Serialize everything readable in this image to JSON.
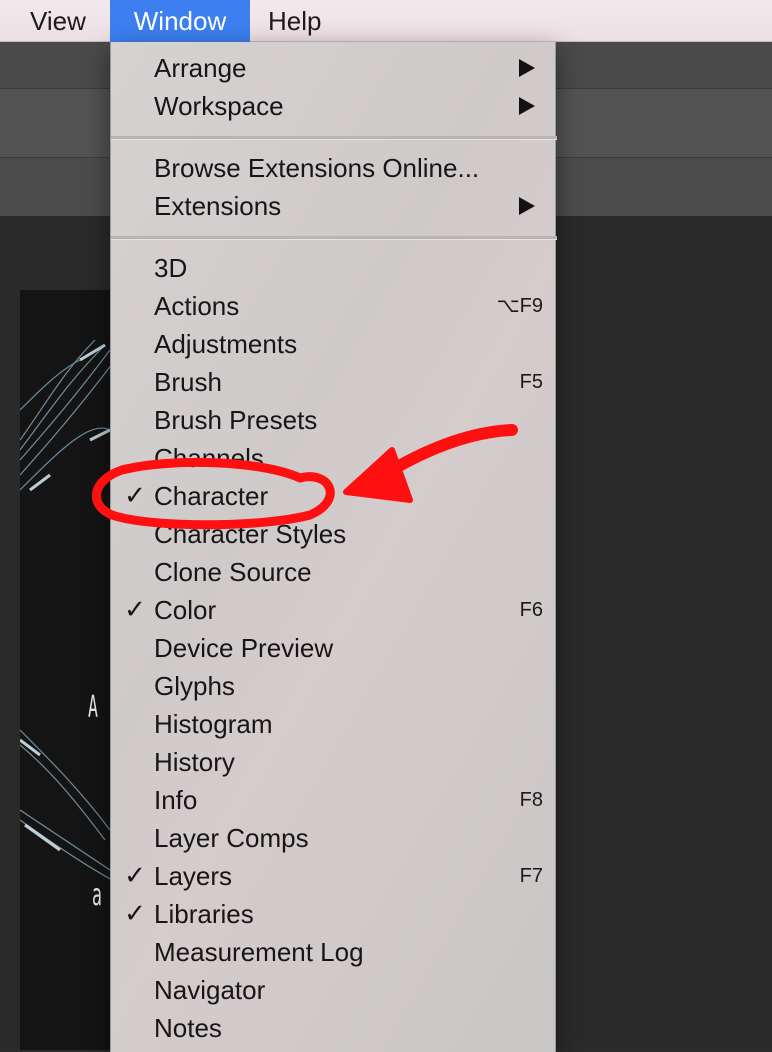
{
  "menubar": {
    "items": [
      {
        "label": "View"
      },
      {
        "label": "Window"
      },
      {
        "label": "Help"
      }
    ]
  },
  "window_menu": {
    "items": [
      {
        "label": "Arrange",
        "has_submenu": true
      },
      {
        "label": "Workspace",
        "has_submenu": true
      },
      {
        "label": "Browse Extensions Online..."
      },
      {
        "label": "Extensions",
        "has_submenu": true
      },
      {
        "label": "3D"
      },
      {
        "label": "Actions",
        "shortcut": "⌥F9"
      },
      {
        "label": "Adjustments"
      },
      {
        "label": "Brush",
        "shortcut": "F5"
      },
      {
        "label": "Brush Presets"
      },
      {
        "label": "Channels"
      },
      {
        "label": "Character",
        "checked": true,
        "check": "✓"
      },
      {
        "label": "Character Styles"
      },
      {
        "label": "Clone Source"
      },
      {
        "label": "Color",
        "checked": true,
        "check": "✓",
        "shortcut": "F6"
      },
      {
        "label": "Device Preview"
      },
      {
        "label": "Glyphs"
      },
      {
        "label": "Histogram"
      },
      {
        "label": "History"
      },
      {
        "label": "Info",
        "shortcut": "F8"
      },
      {
        "label": "Layer Comps"
      },
      {
        "label": "Layers",
        "checked": true,
        "check": "✓",
        "shortcut": "F7"
      },
      {
        "label": "Libraries",
        "checked": true,
        "check": "✓"
      },
      {
        "label": "Measurement Log"
      },
      {
        "label": "Navigator"
      },
      {
        "label": "Notes"
      }
    ]
  },
  "canvas": {
    "glyphs": [
      "A",
      "a"
    ]
  },
  "colors": {
    "menubar_active": "#3d7ff0",
    "annotation": "#ff1010"
  },
  "icons": {
    "submenu": "submenu-arrow-icon",
    "check": "checkmark-icon",
    "annotation_arrow": "red-arrow-annotation",
    "annotation_circle": "red-circle-annotation"
  }
}
